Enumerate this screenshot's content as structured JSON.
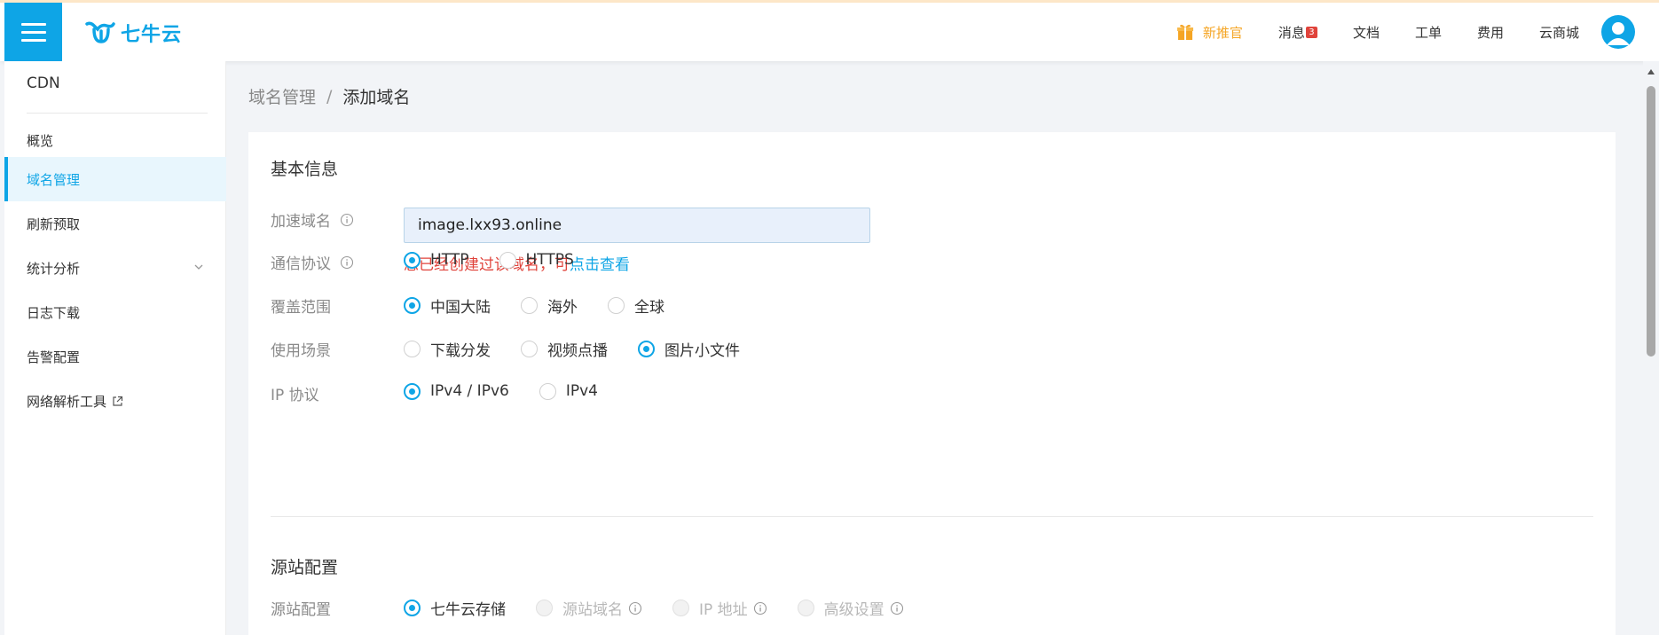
{
  "header": {
    "logo_text": "七牛云",
    "nav": {
      "promo": "新推官",
      "messages": "消息",
      "messages_badge": "3",
      "docs": "文档",
      "tickets": "工单",
      "billing": "费用",
      "marketplace": "云商城"
    }
  },
  "sidebar": {
    "title": "CDN",
    "items": [
      {
        "label": "概览"
      },
      {
        "label": "域名管理"
      },
      {
        "label": "刷新预取"
      },
      {
        "label": "统计分析"
      },
      {
        "label": "日志下载"
      },
      {
        "label": "告警配置"
      },
      {
        "label": "网络解析工具"
      }
    ]
  },
  "breadcrumb": {
    "parent": "域名管理",
    "separator": "/",
    "current": "添加域名"
  },
  "basic_info": {
    "title": "基本信息",
    "domain": {
      "label": "加速域名",
      "value": "image.lxx93.online",
      "error_text": "您已经创建过该域名，可",
      "error_link": "点击查看"
    },
    "protocol": {
      "label": "通信协议",
      "options": [
        "HTTP",
        "HTTPS"
      ],
      "selected": "HTTP"
    },
    "coverage": {
      "label": "覆盖范围",
      "options": [
        "中国大陆",
        "海外",
        "全球"
      ],
      "selected": "中国大陆"
    },
    "scenario": {
      "label": "使用场景",
      "options": [
        "下载分发",
        "视频点播",
        "图片小文件"
      ],
      "selected": "图片小文件"
    },
    "ip_protocol": {
      "label": "IP 协议",
      "options": [
        "IPv4 / IPv6",
        "IPv4"
      ],
      "selected": "IPv4 / IPv6"
    }
  },
  "origin": {
    "title": "源站配置",
    "label": "源站配置",
    "options": [
      "七牛云存储",
      "源站域名",
      "IP 地址",
      "高级设置"
    ],
    "selected": "七牛云存储"
  },
  "colors": {
    "accent": "#0ea5e6",
    "error": "#e0433b",
    "promo": "#f5a524"
  }
}
